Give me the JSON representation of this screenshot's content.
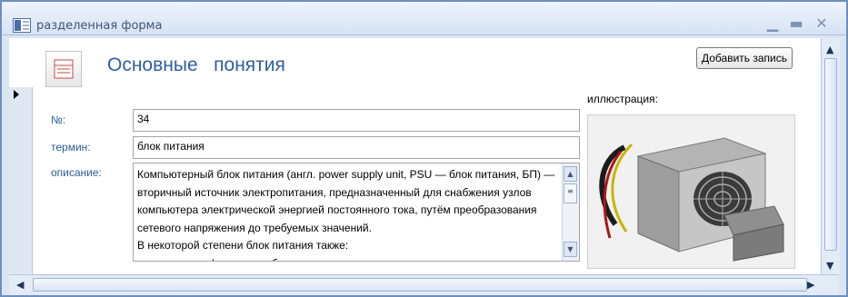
{
  "window": {
    "title": "разделенная форма"
  },
  "header": {
    "title": "Основные   понятия",
    "add_button": "Добавить запись"
  },
  "fields": {
    "number_label": "№:",
    "number_value": "34",
    "term_label": "термин:",
    "term_value": "блок питания",
    "description_label": "описание:",
    "description_value": "Компьютерный блок питания (англ. power supply unit, PSU — блок питания, БП) — вторичный источник электропитания, предназначенный для снабжения узлов компьютера электрической энергией постоянного тока, путём преобразования сетевого напряжения до требуемых значений.\nВ некоторой степени блок питания также:\n— выполняет функции стабилизации и защиты от незначительных помех"
  },
  "illustration": {
    "label": "иллюстрация:"
  },
  "colors": {
    "label_text": "#2b5c98",
    "title_text": "#2f5e9c",
    "frame": "#6d8fbf"
  }
}
